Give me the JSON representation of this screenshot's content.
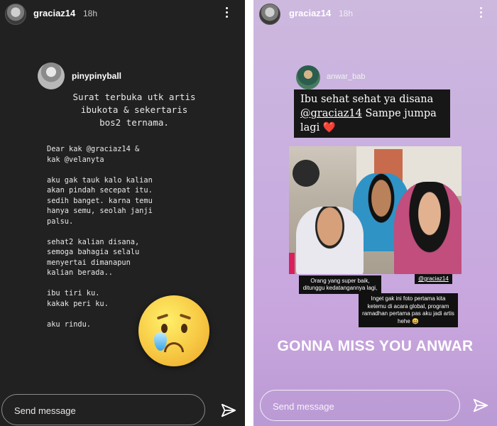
{
  "left_story": {
    "username": "graciaz14",
    "time": "18h",
    "post_user": "pinypinyball",
    "letter_title": "Surat terbuka utk artis\nibukota & sekertaris\nbos2 ternama.",
    "letter_body": "Dear kak @graciaz14 &\nkak @velanyta\n\naku gak tauk kalo kalian\nakan pindah secepat itu.\nsedih banget. karna temu\nhanya semu, seolah janji\npalsu.\n\nsehat2 kalian disana,\nsemoga bahagia selalu\nmenyertai dimanapun\nkalian berada..\n\nibu tiri ku.\nkakak peri ku.\n\naku rindu.",
    "emoji": "crying-face-emoji",
    "message_placeholder": "Send message"
  },
  "right_story": {
    "username": "graciaz14",
    "time": "18h",
    "post_user": "anwar_bab",
    "note_part1": "Ibu sehat sehat ya disana",
    "note_mention": "@graciaz14",
    "note_part2": "Sampe jumpa lagi",
    "note_heart": "❤️",
    "caption": "Orang yang super baik, ditunggu kedatangannya lagi,",
    "photo_tag": "@graciaz14",
    "long_text": "Inget gak ini foto pertama kita ketemu di acara global, program ramadhan pertama pas aku jadi artis hehe 😄",
    "headline": "GONNA MISS YOU ANWAR",
    "message_placeholder": "Send message"
  },
  "colors": {
    "left_bg": "#212121",
    "right_bg": "#c8aee0",
    "note_bg": "#171717",
    "heart": "#e32222"
  },
  "icons": [
    "more-vert-icon",
    "send-icon",
    "avatar"
  ]
}
